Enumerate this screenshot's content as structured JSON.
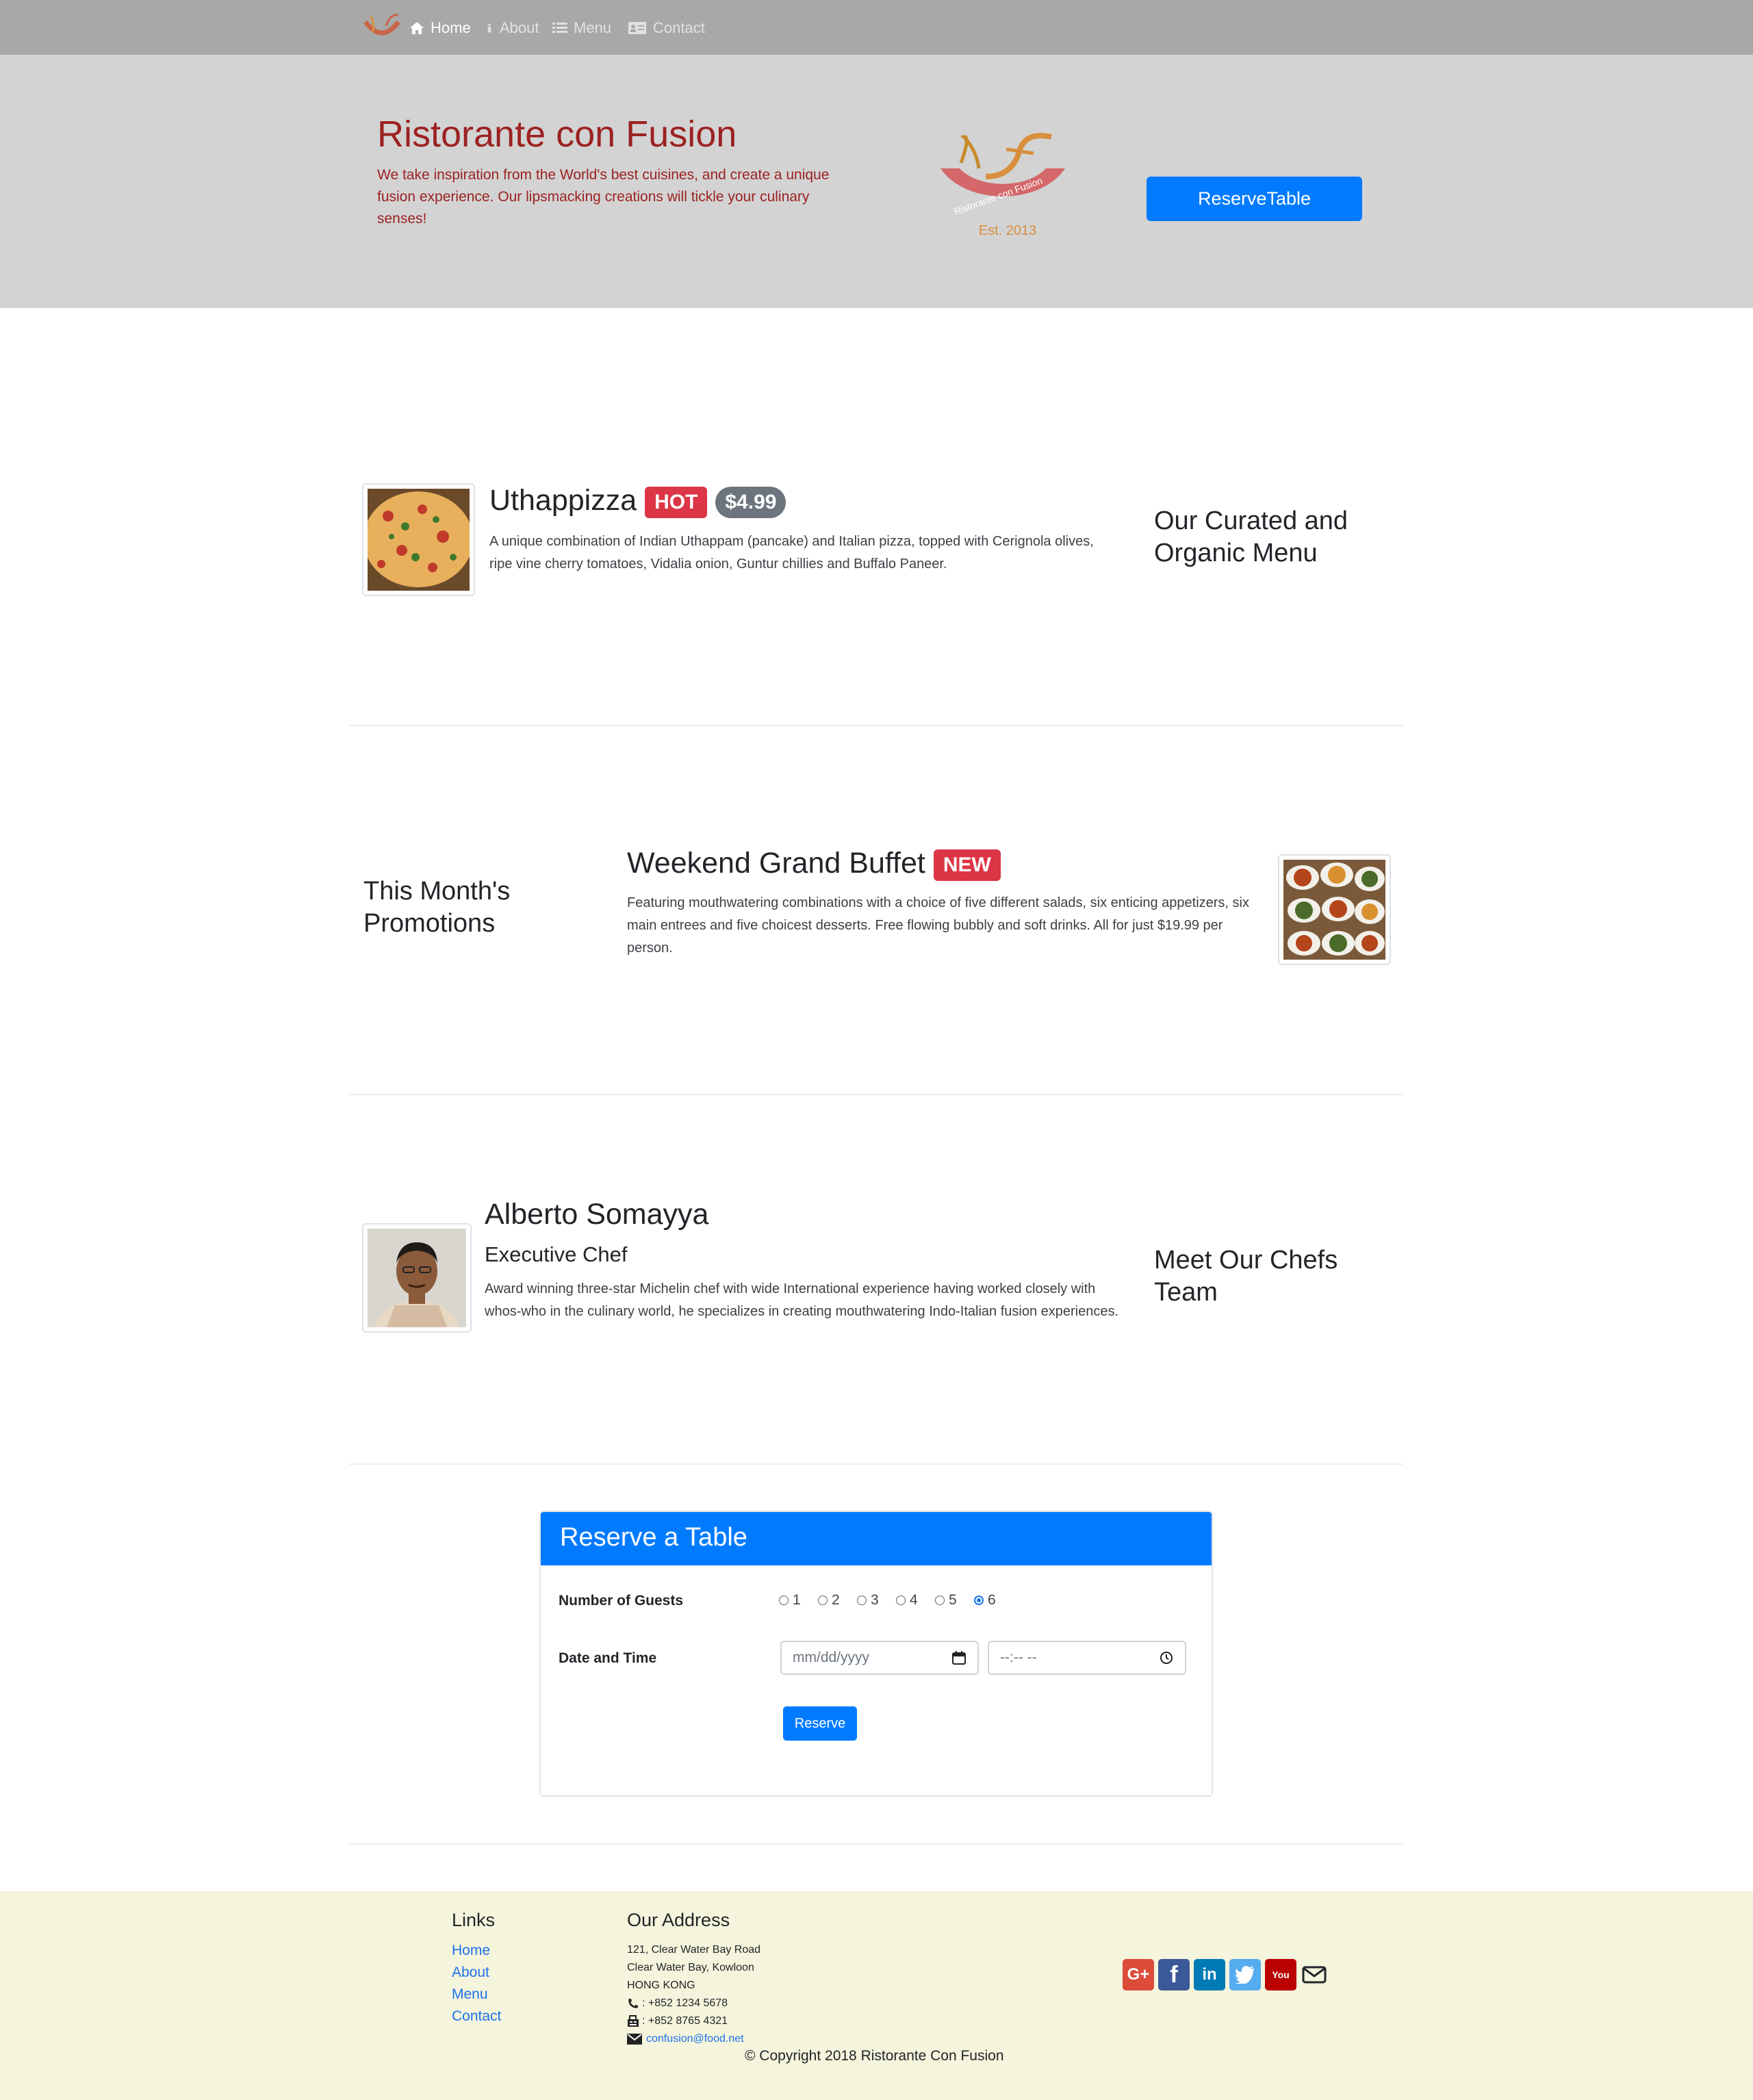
{
  "nav": {
    "items": [
      {
        "label": "Home",
        "icon": "home-icon",
        "active": true
      },
      {
        "label": "About",
        "icon": "info-icon",
        "active": false
      },
      {
        "label": "Menu",
        "icon": "list-icon",
        "active": false
      },
      {
        "label": "Contact",
        "icon": "address-card-icon",
        "active": false
      }
    ]
  },
  "jumbotron": {
    "title": "Ristorante con Fusion",
    "description": "We take inspiration from the World's best cuisines, and create a unique fusion experience. Our lipsmacking creations will tickle your culinary senses!",
    "logo_text": "Ristorante con Fusion",
    "logo_est": "Est. 2013",
    "reserve_button": "ReserveTable"
  },
  "dish": {
    "name": "Uthappizza",
    "badge": "HOT",
    "price": "$4.99",
    "description": "A unique combination of Indian Uthappam (pancake) and Italian pizza, topped with Cerignola olives, ripe vine cherry tomatoes, Vidalia onion, Guntur chillies and Buffalo Paneer.",
    "side_title": "Our Curated and Organic Menu"
  },
  "promotion": {
    "side_title": "This Month's Promotions",
    "name": "Weekend Grand Buffet",
    "badge": "NEW",
    "description": "Featuring mouthwatering combinations with a choice of five different salads, six enticing appetizers, six main entrees and five choicest desserts. Free flowing bubbly and soft drinks. All for just $19.99 per person."
  },
  "chef": {
    "name": "Alberto Somayya",
    "designation": "Executive Chef",
    "description": "Award winning three-star Michelin chef with wide International experience having worked closely with whos-who in the culinary world, he specializes in creating mouthwatering Indo-Italian fusion experiences.",
    "side_title": "Meet Our Chefs Team"
  },
  "reserve_form": {
    "title": "Reserve a Table",
    "guests_label": "Number of Guests",
    "guest_options": [
      "1",
      "2",
      "3",
      "4",
      "5",
      "6"
    ],
    "selected_guests": "6",
    "datetime_label": "Date and Time",
    "date_placeholder": "mm/dd/yyyy",
    "time_placeholder": "--:-- --",
    "submit": "Reserve"
  },
  "footer": {
    "links_title": "Links",
    "links": [
      "Home",
      "About",
      "Menu",
      "Contact"
    ],
    "address_title": "Our Address",
    "address_lines": [
      "121, Clear Water Bay Road",
      "Clear Water Bay, Kowloon",
      "HONG KONG"
    ],
    "phone": ": +852 1234 5678",
    "fax": ": +852 8765 4321",
    "email": "confusion@food.net",
    "social": [
      {
        "icon": "google-plus-icon",
        "glyph": "G+",
        "color": "#dd4b39"
      },
      {
        "icon": "facebook-icon",
        "glyph": "f",
        "color": "#3b5998"
      },
      {
        "icon": "linkedin-icon",
        "glyph": "in",
        "color": "#007bb6"
      },
      {
        "icon": "twitter-icon",
        "glyph": "t",
        "color": "#55acee"
      },
      {
        "icon": "youtube-icon",
        "glyph": "You",
        "color": "#bb0000"
      },
      {
        "icon": "envelope-icon",
        "glyph": "",
        "color": "#212529"
      }
    ],
    "copyright": "© Copyright 2018 Ristorante Con Fusion"
  }
}
